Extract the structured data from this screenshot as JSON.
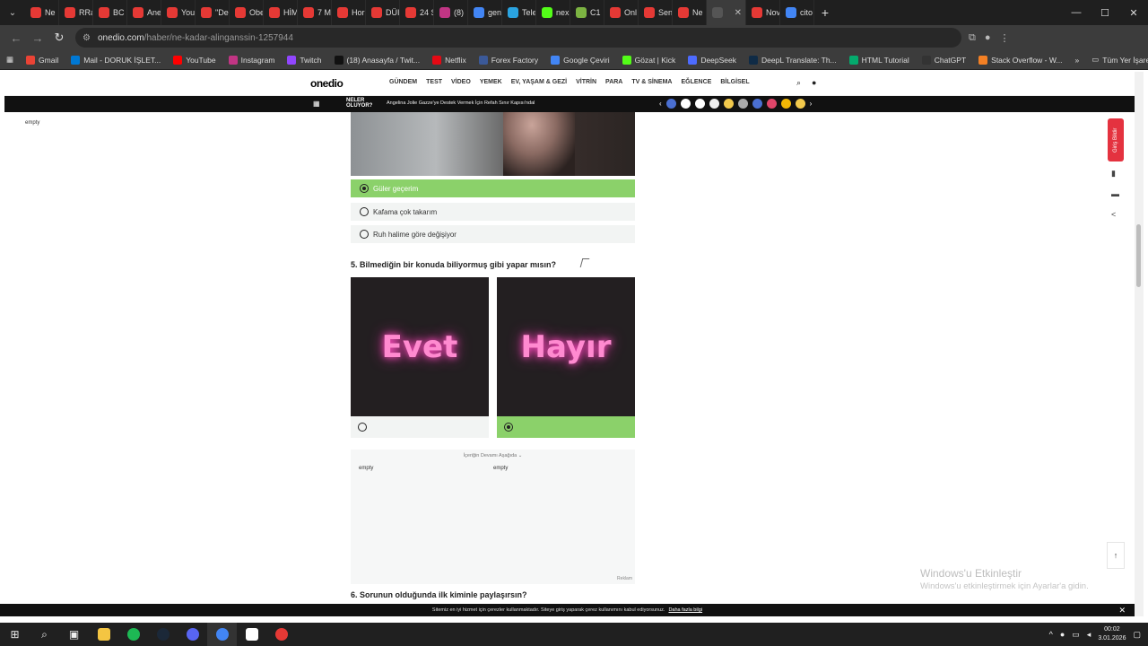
{
  "browser": {
    "tabs": [
      {
        "label": "Ne",
        "color": "#e53935"
      },
      {
        "label": "RRa",
        "color": "#e53935"
      },
      {
        "label": "BC",
        "color": "#e53935"
      },
      {
        "label": "Ane",
        "color": "#e53935"
      },
      {
        "label": "You",
        "color": "#e53935"
      },
      {
        "label": "\"De",
        "color": "#e53935"
      },
      {
        "label": "Obe",
        "color": "#e53935"
      },
      {
        "label": "HİM",
        "color": "#e53935"
      },
      {
        "label": "7 M",
        "color": "#e53935"
      },
      {
        "label": "Hor",
        "color": "#e53935"
      },
      {
        "label": "DÜI",
        "color": "#e53935"
      },
      {
        "label": "24 S",
        "color": "#e53935"
      },
      {
        "label": "(8)",
        "color": "#c13584"
      },
      {
        "label": "gen",
        "color": "#4285f4"
      },
      {
        "label": "Tele",
        "color": "#2aa3e0"
      },
      {
        "label": "nex",
        "color": "#53fc18"
      },
      {
        "label": "C1",
        "color": "#7cb342"
      },
      {
        "label": "Onl",
        "color": "#e53935"
      },
      {
        "label": "Sen",
        "color": "#e53935"
      },
      {
        "label": "Ne",
        "color": "#e53935"
      },
      {
        "label": "",
        "color": "#555555",
        "active": true
      },
      {
        "label": "Nov",
        "color": "#e53935"
      },
      {
        "label": "cito",
        "color": "#4285f4"
      }
    ],
    "url_domain": "onedio.com",
    "url_path": "/haber/ne-kadar-alinganssin-1257944",
    "bookmarks": [
      {
        "label": "Gmail",
        "color": "#ea4335"
      },
      {
        "label": "Mail - DORUK İŞLET...",
        "color": "#0078d4"
      },
      {
        "label": "YouTube",
        "color": "#ff0000"
      },
      {
        "label": "Instagram",
        "color": "#c13584"
      },
      {
        "label": "Twitch",
        "color": "#9146ff"
      },
      {
        "label": "(18) Anasayfa / Twit...",
        "color": "#111111"
      },
      {
        "label": "Netflix",
        "color": "#e50914"
      },
      {
        "label": "Forex Factory",
        "color": "#3b5998"
      },
      {
        "label": "Google Çeviri",
        "color": "#4285f4"
      },
      {
        "label": "Gözat | Kick",
        "color": "#53fc18"
      },
      {
        "label": "DeepSeek",
        "color": "#4d6bfe"
      },
      {
        "label": "DeepL Translate: Th...",
        "color": "#0f2b46"
      },
      {
        "label": "HTML Tutorial",
        "color": "#04aa6d"
      },
      {
        "label": "ChatGPT",
        "color": "#333333"
      },
      {
        "label": "Stack Overflow - W...",
        "color": "#f48024"
      }
    ],
    "all_bookmarks": "Tüm Yer İşaretleri"
  },
  "site": {
    "logo": "onedio",
    "nav": [
      "GÜNDEM",
      "TEST",
      "VİDEO",
      "YEMEK",
      "EV, YAŞAM & GEZİ",
      "VİTRİN",
      "PARA",
      "TV & SİNEMA",
      "EĞLENCE",
      "BİLGİSEL"
    ],
    "ticker_label": "NELER OLUYOR?",
    "ticker_text": "Angelina Jolie Gazze'ye Destek Vermek İçin Refah Sınır Kapısı'ndal",
    "side_empty": "empty",
    "right_button": "Giriş Bildir"
  },
  "quiz": {
    "q4_options": [
      {
        "label": "Güler geçerim",
        "selected": true
      },
      {
        "label": "Kafama çok takarım",
        "selected": false
      },
      {
        "label": "Ruh halime göre değişiyor",
        "selected": false
      }
    ],
    "q5": "5. Bilmediğin bir konuda biliyormuş gibi yapar mısın?",
    "q5_options": [
      {
        "label": "Evet",
        "selected": false
      },
      {
        "label": "Hayır",
        "selected": true
      }
    ],
    "ad_caption": "İçeriğin Devamı Aşağıda ⌄",
    "ad_empty1": "empty",
    "ad_empty2": "empty",
    "ad_label": "Reklam",
    "q6": "6. Sorunun olduğunda ilk kiminle paylaşırsın?"
  },
  "overlay": {
    "cookie_text": "Sitemiz en iyi hizmet için çerezler kullanmaktadır. Siteye giriş yaparak çerez kullanımını kabul ediyorsunuz.",
    "cookie_link": "Daha fazla bilgi",
    "activate_title": "Windows'u Etkinleştir",
    "activate_sub": "Windows'u etkinleştirmek için Ayarlar'a gidin."
  },
  "taskbar": {
    "time": "00:02",
    "date": "3.01.2026"
  }
}
